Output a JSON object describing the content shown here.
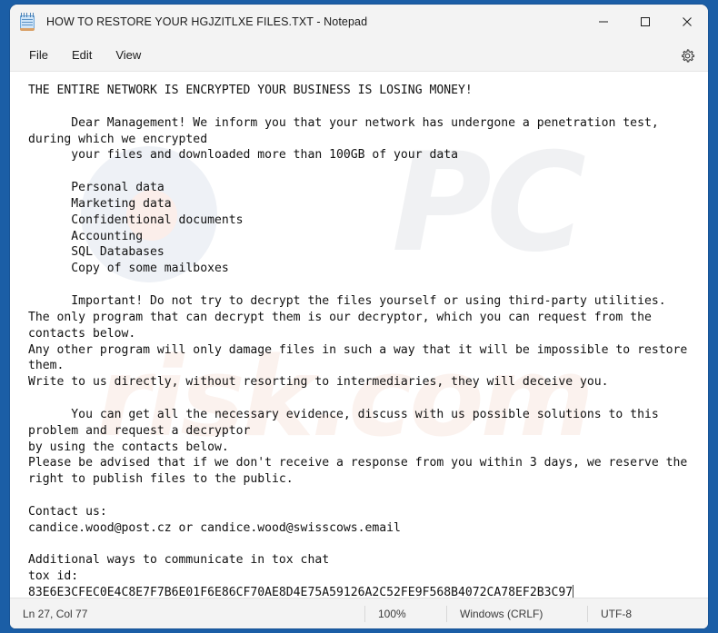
{
  "window": {
    "title": "HOW TO RESTORE YOUR HGJZITLXE FILES.TXT - Notepad",
    "app_icon": "notepad-icon",
    "frame_color": "#1b5ea6",
    "chrome_color": "#f3f3f3",
    "controls": {
      "minimize": "minimize-icon",
      "maximize": "maximize-icon",
      "close": "close-icon"
    }
  },
  "menubar": {
    "items": [
      {
        "label": "File"
      },
      {
        "label": "Edit"
      },
      {
        "label": "View"
      }
    ],
    "settings_icon": "gear-icon"
  },
  "document": {
    "lines": [
      "THE ENTIRE NETWORK IS ENCRYPTED YOUR BUSINESS IS LOSING MONEY!",
      "",
      "      Dear Management! We inform you that your network has undergone a penetration test,",
      "during which we encrypted",
      "      your files and downloaded more than 100GB of your data",
      "",
      "      Personal data",
      "      Marketing data",
      "      Confidentional documents",
      "      Accounting",
      "      SQL Databases",
      "      Copy of some mailboxes",
      "",
      "      Important! Do not try to decrypt the files yourself or using third-party utilities.",
      "The only program that can decrypt them is our decryptor, which you can request from the",
      "contacts below.",
      "Any other program will only damage files in such a way that it will be impossible to restore",
      "them.",
      "Write to us directly, without resorting to intermediaries, they will deceive you.",
      "",
      "      You can get all the necessary evidence, discuss with us possible solutions to this",
      "problem and request a decryptor",
      "by using the contacts below.",
      "Please be advised that if we don't receive a response from you within 3 days, we reserve the",
      "right to publish files to the public.",
      "",
      "Contact us:",
      "candice.wood@post.cz or candice.wood@swisscows.email",
      "",
      "Additional ways to communicate in tox chat",
      "tox id:",
      "83E6E3CFEC0E4C8E7F7B6E01F6E86CF70AE8D4E75A59126A2C52FE9F568B4072CA78EF2B3C97"
    ],
    "emails": [
      "candice.wood@post.cz",
      "candice.wood@swisscows.email"
    ],
    "tox_id": "83E6E3CFEC0E4C8E7F7B6E01F6E86CF70AE8D4E75A59126A2C52FE9F568B4072CA78EF2B3C97",
    "ransom_deadline_days": 3,
    "exfiltrated_size": "100GB",
    "caret_visible": true
  },
  "statusbar": {
    "position": "Ln 27, Col 77",
    "zoom": "100%",
    "line_ending": "Windows (CRLF)",
    "encoding": "UTF-8"
  },
  "watermark": {
    "text1": "PC",
    "text2": "risk.com"
  }
}
